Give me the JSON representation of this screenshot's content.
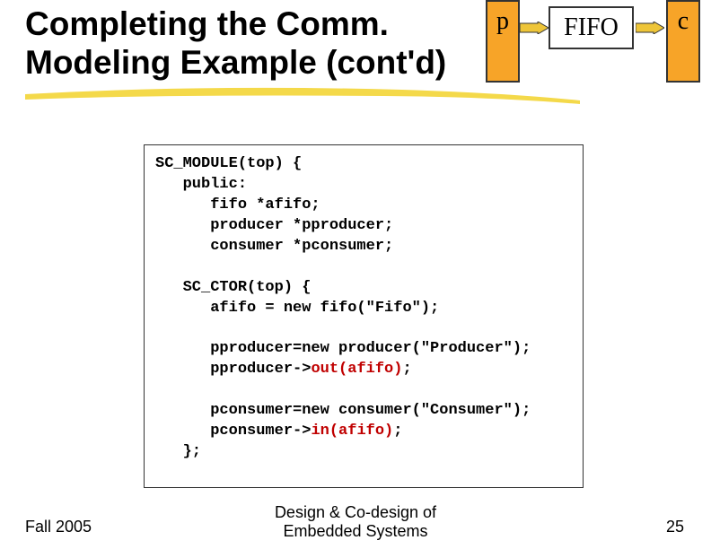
{
  "title": {
    "line1": "Completing the Comm.",
    "line2": "Modeling Example (cont'd)"
  },
  "diagram": {
    "p": "p",
    "fifo": "FIFO",
    "c": "c"
  },
  "code": {
    "l1": "SC_MODULE(top) {",
    "l2": "   public:",
    "l3": "      fifo *afifo;",
    "l4": "      producer *pproducer;",
    "l5": "      consumer *pconsumer;",
    "l6": "",
    "l7": "   SC_CTOR(top) {",
    "l8": "      afifo = new fifo(\"Fifo\");",
    "l9": "",
    "l10a": "      pproducer=new producer(\"Producer\");",
    "l11a": "      pproducer->",
    "l11b": "out(afifo)",
    "l11c": ";",
    "l12": "",
    "l13a": "      pconsumer=new consumer(\"Consumer\");",
    "l14a": "      pconsumer->",
    "l14b": "in(afifo)",
    "l14c": ";",
    "l15": "   };"
  },
  "footer": {
    "left": "Fall 2005",
    "center1": "Design & Co-design of",
    "center2": "Embedded Systems",
    "right": "25"
  }
}
